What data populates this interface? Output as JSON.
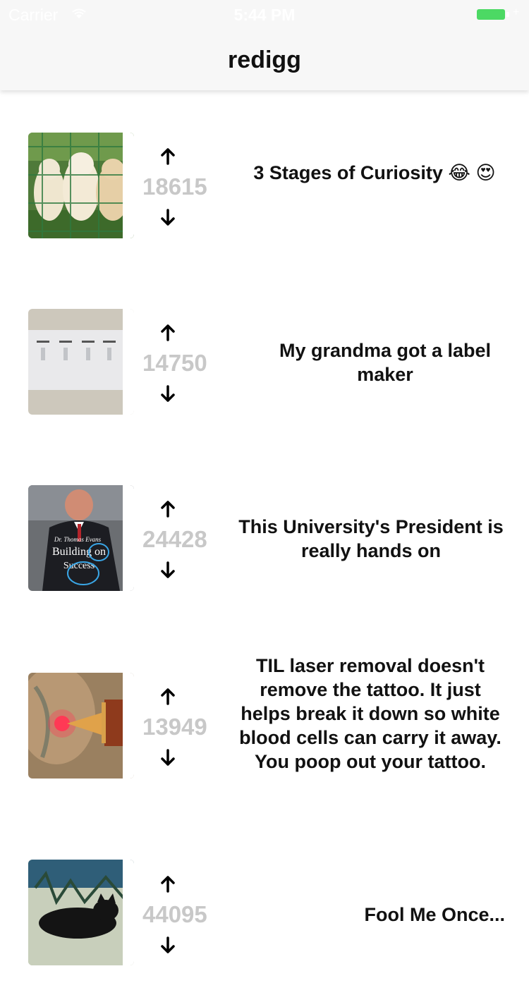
{
  "status_bar": {
    "carrier": "Carrier",
    "time": "5:44 PM"
  },
  "nav": {
    "title": "redigg"
  },
  "posts": [
    {
      "score": "18615",
      "title": "3 Stages of Curiosity 😂 😍",
      "thumbnail_icon": "puppies-image"
    },
    {
      "score": "14750",
      "title": "My grandma got a label maker",
      "thumbnail_icon": "light-switches-image"
    },
    {
      "score": "24428",
      "title": "This University's President is really hands on",
      "thumbnail_icon": "president-photo-image",
      "thumbnail_text": [
        "Dr. Thomas Evans",
        "Building on",
        "Success"
      ]
    },
    {
      "score": "13949",
      "title": "TIL laser removal doesn't remove the tattoo. It just helps break it down so white blood cells can carry it away. You poop out your tattoo.",
      "thumbnail_icon": "tattoo-laser-image"
    },
    {
      "score": "44095",
      "title": "Fool Me Once...",
      "thumbnail_icon": "cat-image"
    }
  ],
  "colors": {
    "score": "#c8c8c8",
    "battery": "#4cd964",
    "nav_background": "#f7f7f7"
  }
}
